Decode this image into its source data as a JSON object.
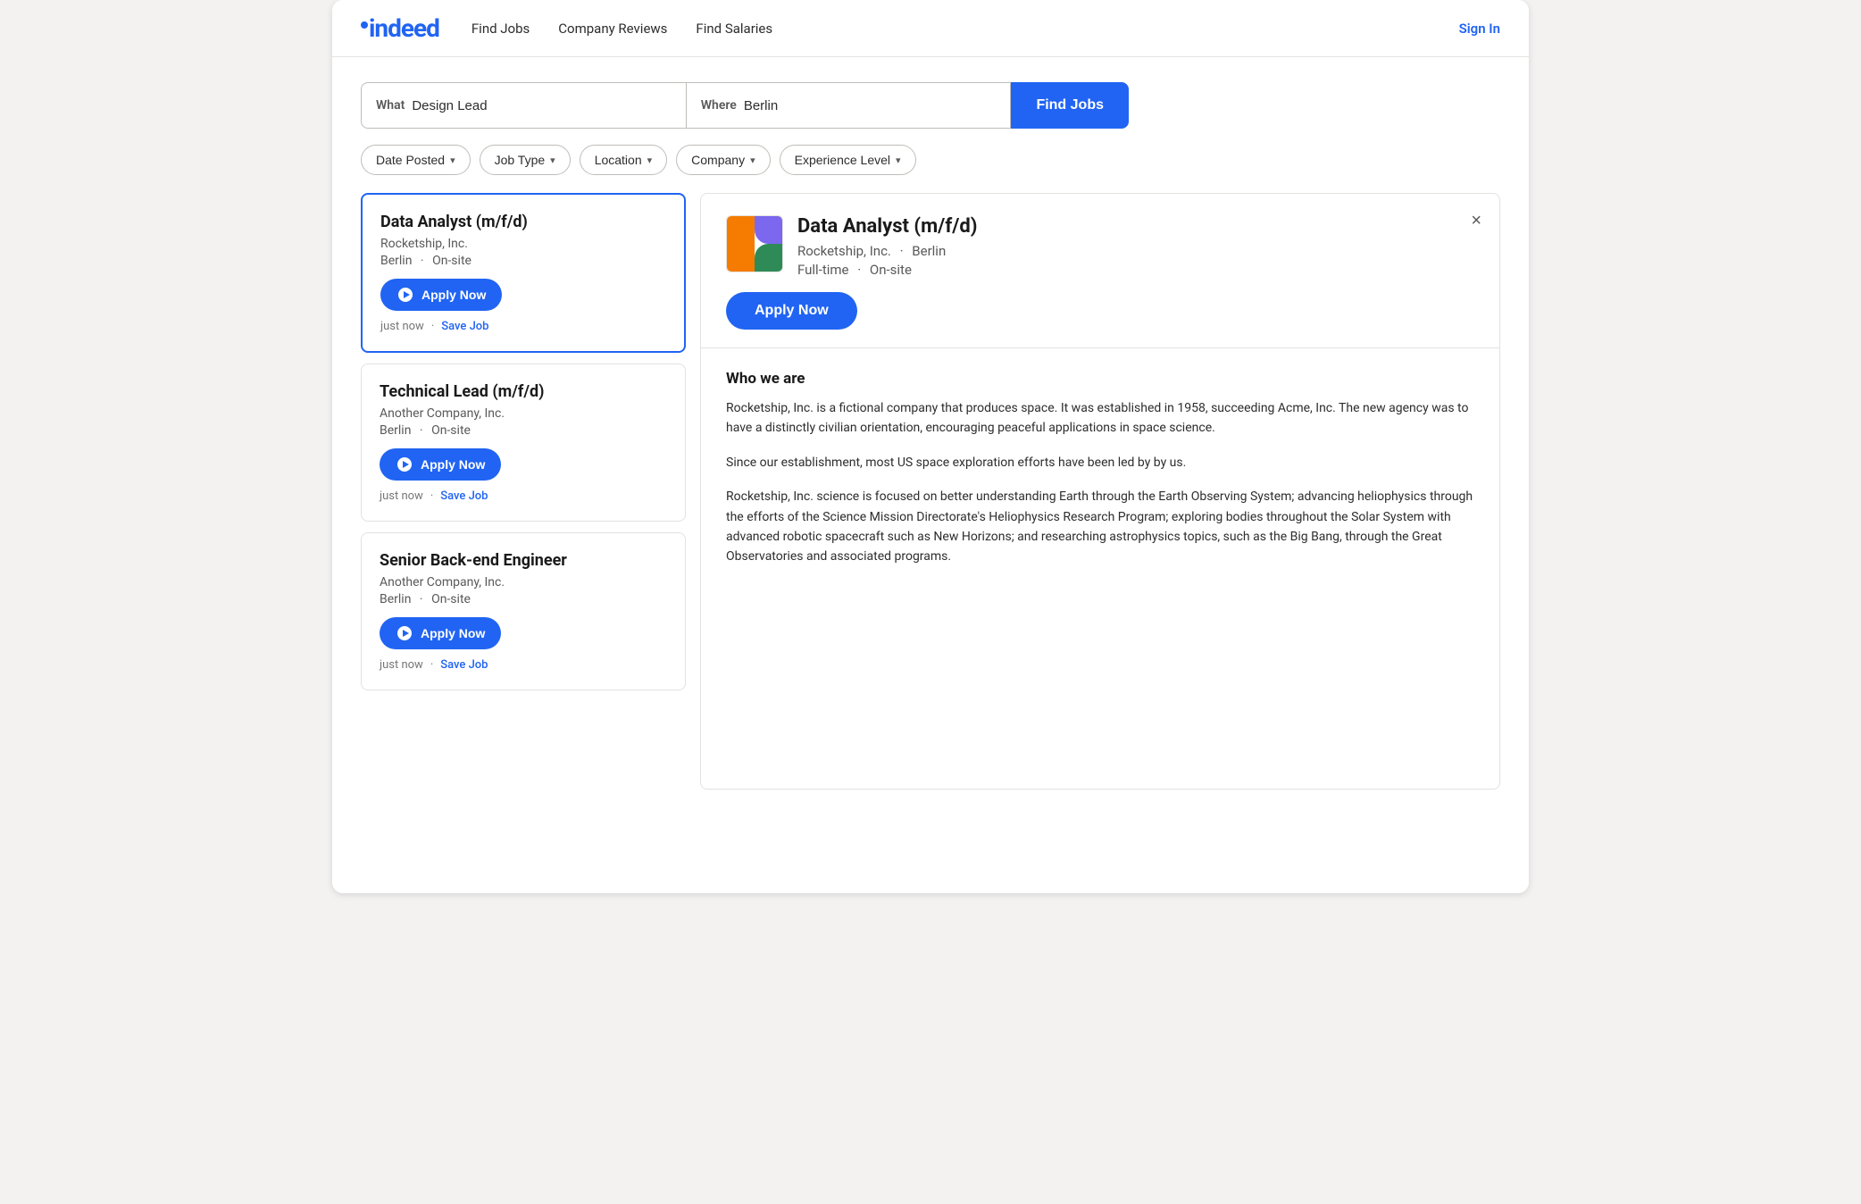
{
  "nav": {
    "logo_text": "indeed",
    "links": [
      {
        "label": "Find Jobs",
        "id": "find-jobs"
      },
      {
        "label": "Company Reviews",
        "id": "company-reviews"
      },
      {
        "label": "Find Salaries",
        "id": "find-salaries"
      }
    ],
    "sign_in_label": "Sign In"
  },
  "search": {
    "what_label": "What",
    "what_value": "Design Lead",
    "where_label": "Where",
    "where_value": "Berlin",
    "find_jobs_label": "Find Jobs"
  },
  "filters": [
    {
      "label": "Date Posted",
      "id": "date-posted"
    },
    {
      "label": "Job Type",
      "id": "job-type"
    },
    {
      "label": "Location",
      "id": "location"
    },
    {
      "label": "Company",
      "id": "company"
    },
    {
      "label": "Experience Level",
      "id": "experience-level"
    }
  ],
  "job_list": [
    {
      "id": "job1",
      "title": "Data Analyst (m/f/d)",
      "company": "Rocketship, Inc.",
      "location": "Berlin",
      "work_type": "On-site",
      "apply_label": "Apply Now",
      "posted": "just now",
      "save_label": "Save Job",
      "active": true
    },
    {
      "id": "job2",
      "title": "Technical Lead (m/f/d)",
      "company": "Another Company, Inc.",
      "location": "Berlin",
      "work_type": "On-site",
      "apply_label": "Apply Now",
      "posted": "just now",
      "save_label": "Save Job",
      "active": false
    },
    {
      "id": "job3",
      "title": "Senior Back-end Engineer",
      "company": "Another Company, Inc.",
      "location": "Berlin",
      "work_type": "On-site",
      "apply_label": "Apply Now",
      "posted": "just now",
      "save_label": "Save Job",
      "active": false
    }
  ],
  "job_detail": {
    "title": "Data Analyst (m/f/d)",
    "company": "Rocketship, Inc.",
    "location": "Berlin",
    "job_type": "Full-time",
    "work_type": "On-site",
    "apply_label": "Apply Now",
    "close_label": "×",
    "who_we_are_title": "Who we are",
    "paragraphs": [
      "Rocketship, Inc. is a fictional company that produces space. It was established in 1958, succeeding Acme, Inc. The new agency was to have a distinctly civilian orientation, encouraging peaceful applications in space science.",
      "Since our establishment, most US space exploration efforts have been led by by us.",
      "Rocketship, Inc. science is focused on better understanding Earth through the Earth Observing System; advancing heliophysics through the efforts of the Science Mission Directorate's Heliophysics Research Program; exploring bodies throughout the Solar System with advanced robotic spacecraft such as New Horizons; and researching astrophysics topics, such as the Big Bang, through the Great Observatories and associated programs."
    ]
  }
}
